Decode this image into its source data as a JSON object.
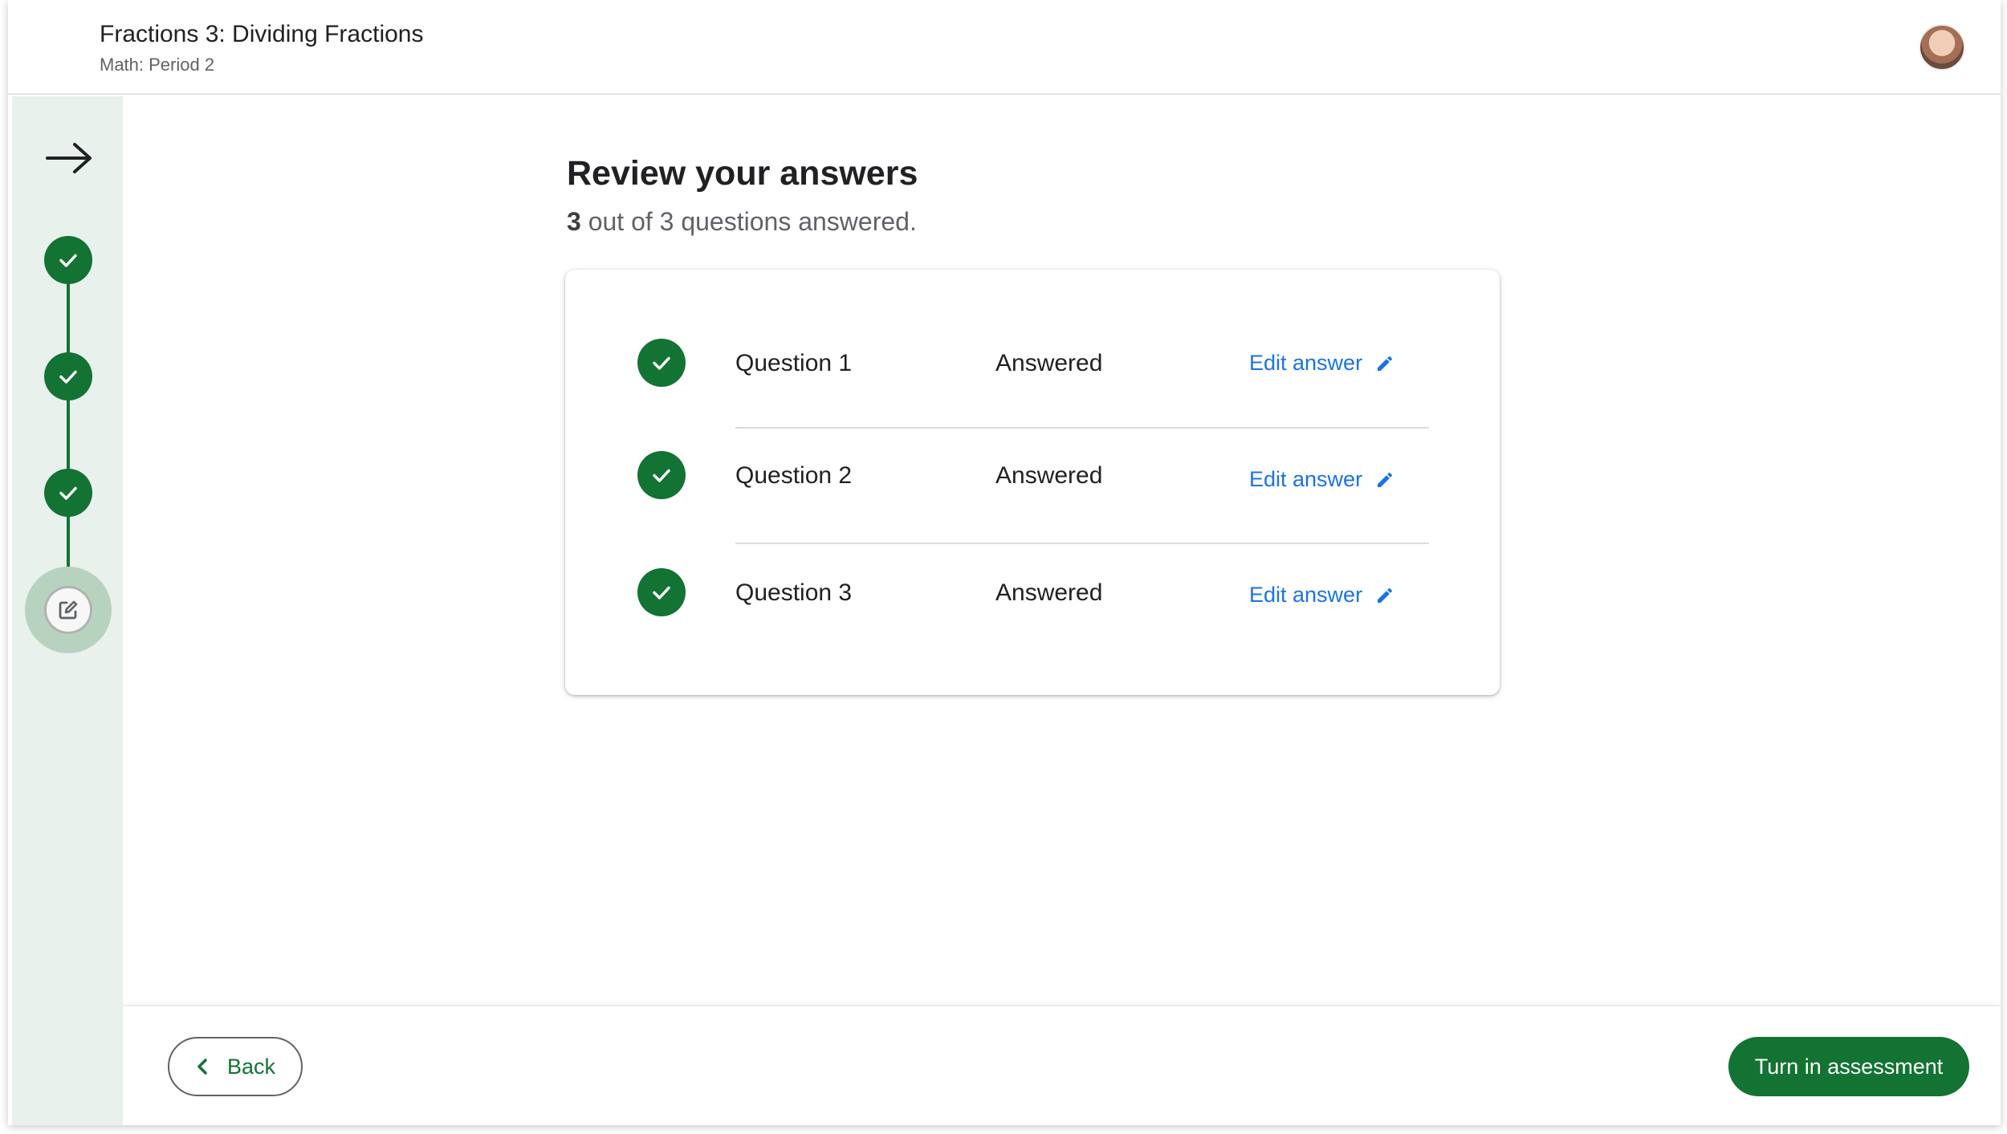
{
  "header": {
    "title": "Fractions 3: Dividing Fractions",
    "subtitle": "Math: Period 2",
    "avatar": "user-avatar"
  },
  "rail": {
    "toggle_icon": "arrow-right-icon",
    "steps": [
      {
        "status": "complete",
        "icon": "check-icon"
      },
      {
        "status": "complete",
        "icon": "check-icon"
      },
      {
        "status": "complete",
        "icon": "check-icon"
      },
      {
        "status": "current",
        "icon": "edit-square-icon"
      }
    ]
  },
  "main": {
    "heading": "Review your answers",
    "summary_count": "3",
    "summary_text": "out of 3 questions answered.",
    "questions": [
      {
        "label": "Question 1",
        "status": "Answered",
        "edit_label": "Edit answer"
      },
      {
        "label": "Question 2",
        "status": "Answered",
        "edit_label": "Edit answer"
      },
      {
        "label": "Question 3",
        "status": "Answered",
        "edit_label": "Edit answer"
      }
    ]
  },
  "footer": {
    "back_label": "Back",
    "turn_in_label": "Turn in assessment"
  },
  "colors": {
    "accent_green": "#137333",
    "link_blue": "#1a73e8",
    "rail_bg": "#e8f1ec"
  }
}
